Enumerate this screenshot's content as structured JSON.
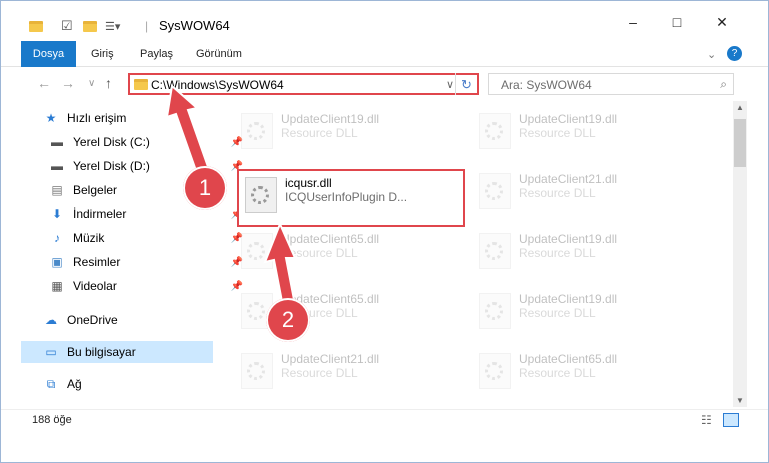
{
  "window": {
    "title": "SysWOW64",
    "minimize": "–",
    "maximize": "□",
    "close": "✕"
  },
  "ribbon": {
    "tabs": [
      {
        "label": "Dosya"
      },
      {
        "label": "Giriş"
      },
      {
        "label": "Paylaş"
      },
      {
        "label": "Görünüm"
      }
    ],
    "collapse": "⌄",
    "help": "?"
  },
  "address": {
    "path": "C:\\Windows\\SysWOW64"
  },
  "search": {
    "placeholder": "Ara: SysWOW64"
  },
  "nav": [
    {
      "label": "Hızlı erişim",
      "icon": "star-icon"
    },
    {
      "label": "Yerel Disk (C:)",
      "icon": "drive-icon"
    },
    {
      "label": "Yerel Disk (D:)",
      "icon": "drive-icon"
    },
    {
      "label": "Belgeler",
      "icon": "document-icon"
    },
    {
      "label": "İndirmeler",
      "icon": "download-icon"
    },
    {
      "label": "Müzik",
      "icon": "music-icon"
    },
    {
      "label": "Resimler",
      "icon": "pictures-icon"
    },
    {
      "label": "Videolar",
      "icon": "video-icon"
    },
    {
      "label": "OneDrive",
      "icon": "cloud-icon"
    },
    {
      "label": "Bu bilgisayar",
      "icon": "computer-icon"
    },
    {
      "label": "Ağ",
      "icon": "network-icon"
    }
  ],
  "files": [
    {
      "name": "UpdateClient19.dll",
      "type": "Resource DLL"
    },
    {
      "name": "UpdateClient19.dll",
      "type": "Resource DLL"
    },
    {
      "name": "icqusr.dll",
      "type": "ICQUserInfoPlugin D..."
    },
    {
      "name": "UpdateClient21.dll",
      "type": "Resource DLL"
    },
    {
      "name": "UpdateClient65.dll",
      "type": "Resource DLL"
    },
    {
      "name": "UpdateClient19.dll",
      "type": "Resource DLL"
    },
    {
      "name": "UpdateClient65.dll",
      "type": "Resource DLL"
    },
    {
      "name": "UpdateClient19.dll",
      "type": "Resource DLL"
    },
    {
      "name": "UpdateClient21.dll",
      "type": "Resource DLL"
    },
    {
      "name": "UpdateClient65.dll",
      "type": "Resource DLL"
    }
  ],
  "status": {
    "count": "188 öğe"
  },
  "annotations": {
    "step1": "1",
    "step2": "2",
    "color": "#e0464c"
  }
}
